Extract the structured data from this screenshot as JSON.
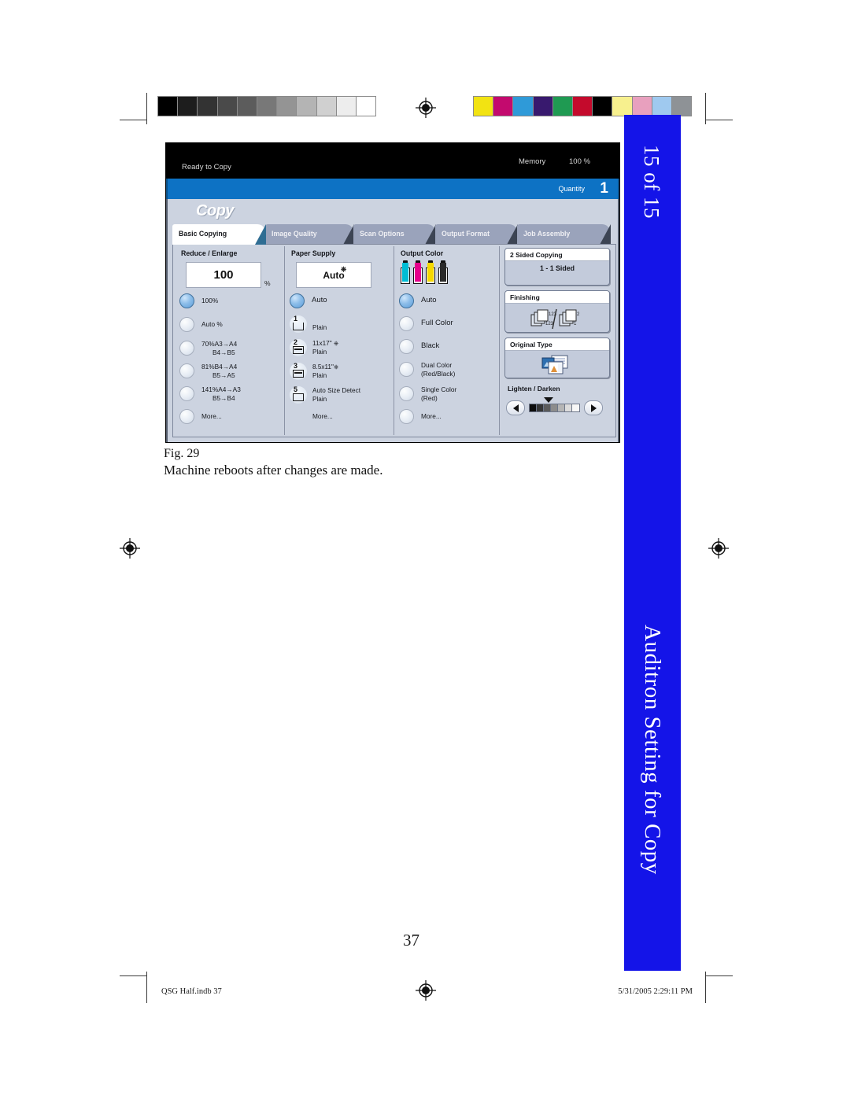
{
  "page": {
    "number": "37",
    "figure_label": "Fig. 29",
    "figure_caption": "Machine reboots after changes are made.",
    "side_tab_top": "15 of 15",
    "side_tab_bottom": "Auditron Setting for Copy",
    "side_tab_color": "#1414e8",
    "footer_left": "QSG Half.indb   37",
    "footer_right": "5/31/2005   2:29:11 PM"
  },
  "print_bars": {
    "grayscale": [
      "#000000",
      "#1d1d1d",
      "#333333",
      "#4a4a4a",
      "#5c5c5c",
      "#787878",
      "#949494",
      "#b4b4b4",
      "#d0d0d0",
      "#ededed",
      "#ffffff"
    ],
    "colors": [
      "#f2e312",
      "#c30a6e",
      "#2f9ad8",
      "#38196e",
      "#1f9a52",
      "#c40a2c",
      "#000000",
      "#f7f08e",
      "#e8a0be",
      "#9fc9ef",
      "#8e9296"
    ]
  },
  "copier_ui": {
    "status": {
      "ready_text": "Ready to Copy",
      "memory_label": "Memory",
      "memory_value": "100 %"
    },
    "quantity": {
      "label": "Quantity",
      "value": "1",
      "bar_color": "#0d72c4"
    },
    "screen_title": "Copy",
    "tabs": [
      {
        "label": "Basic Copying",
        "active": true
      },
      {
        "label": "Image Quality",
        "active": false
      },
      {
        "label": "Scan Options",
        "active": false
      },
      {
        "label": "Output Format",
        "active": false
      },
      {
        "label": "Job Assembly",
        "active": false
      }
    ],
    "reduce_enlarge": {
      "title": "Reduce / Enlarge",
      "value": "100",
      "unit": "%",
      "options": [
        {
          "label": "100%",
          "selected": true
        },
        {
          "label": "Auto %",
          "selected": false
        },
        {
          "label": "70%A3→A4",
          "label2": "B4→B5",
          "selected": false
        },
        {
          "label": "81%B4→A4",
          "label2": "B5→A5",
          "selected": false
        },
        {
          "label": "141%A4→A3",
          "label2": "B5→B4",
          "selected": false
        },
        {
          "label": "More...",
          "selected": false
        }
      ]
    },
    "paper_supply": {
      "title": "Paper Supply",
      "value": "Auto",
      "auto_option": {
        "label": "Auto",
        "selected": true
      },
      "trays": [
        {
          "number": "1",
          "line1": "",
          "line2": "Plain"
        },
        {
          "number": "2",
          "line1": "11x17\"",
          "line2": "Plain"
        },
        {
          "number": "3",
          "line1": "8.5x11\"",
          "line2": "Plain"
        },
        {
          "number": "5",
          "line1": "Auto Size Detect",
          "line2": "Plain"
        }
      ],
      "more_label": "More..."
    },
    "output_color": {
      "title": "Output Color",
      "toners": [
        {
          "name": "cyan-toner",
          "color": "#00bcd4"
        },
        {
          "name": "magenta-toner",
          "color": "#e6008c"
        },
        {
          "name": "yellow-toner",
          "color": "#f5d800"
        },
        {
          "name": "black-toner",
          "color": "#2a2a2a"
        }
      ],
      "options": [
        {
          "label": "Auto",
          "selected": true
        },
        {
          "label": "Full Color",
          "selected": false
        },
        {
          "label": "Black",
          "selected": false
        },
        {
          "label": "Dual Color",
          "label2": "(Red/Black)",
          "selected": false
        },
        {
          "label": "Single Color",
          "label2": " (Red)",
          "selected": false
        },
        {
          "label": "More...",
          "selected": false
        }
      ]
    },
    "right_panel": {
      "two_sided": {
        "title": "2 Sided Copying",
        "value": "1 - 1 Sided"
      },
      "finishing": {
        "title": "Finishing",
        "icon": "collate-stack-icon"
      },
      "original_type": {
        "title": "Original Type",
        "icon": "photo-text-icon"
      },
      "lighten_darken": {
        "label": "Lighten / Darken",
        "left_arrow": "◀",
        "right_arrow": "▶",
        "steps": [
          "#0d0d0d",
          "#353535",
          "#5a5a5a",
          "#8c8c8c",
          "#b5b5b5",
          "#dcdcdc",
          "#f7f7f7"
        ],
        "marker_index": 2
      }
    }
  }
}
